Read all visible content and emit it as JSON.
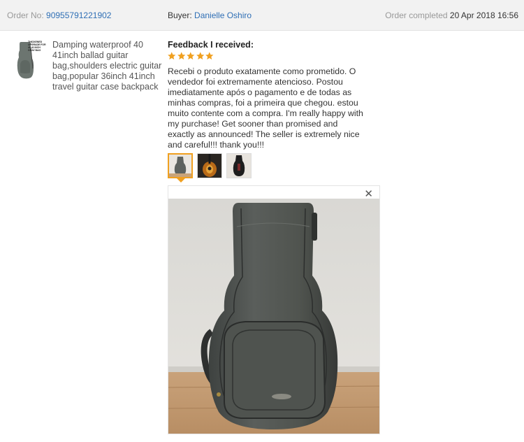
{
  "order": {
    "order_no_label": "Order No:",
    "order_no": "90955791221902",
    "buyer_label": "Buyer:",
    "buyer": "Danielle Oshiro",
    "completed_label": "Order completed",
    "completed_date": "20 Apr 2018 16:56"
  },
  "product": {
    "thumb_text": "THICKENED UPGRADE FOR 40 41 INCH GRAY BAG",
    "title": "Damping waterproof 40 41inch ballad guitar bag,shoulders electric guitar bag,popular 36inch 41inch travel guitar case backpack"
  },
  "feedback": {
    "heading": "Feedback I received:",
    "rating": 5,
    "text": "Recebi o produto exatamente como prometido. O vendedor foi extremamente atencioso. Postou imediatamente após o pagamento e de todas as minhas compras, foi a primeira que chegou. estou muito contente com a compra. I'm really happy with my purchase! Get sooner than promised and exactly as announced! The seller is extremely nice and careful!!! thank you!!!",
    "images": [
      "gray-guitar-bag-photo",
      "sunburst-guitar-photo",
      "black-guitar-bag-photo"
    ],
    "selected_image": 0
  },
  "viewer": {
    "close_icon": "close-icon"
  },
  "colors": {
    "star": "#f0a020",
    "link": "#2f6fb5",
    "accent": "#f0a020"
  }
}
